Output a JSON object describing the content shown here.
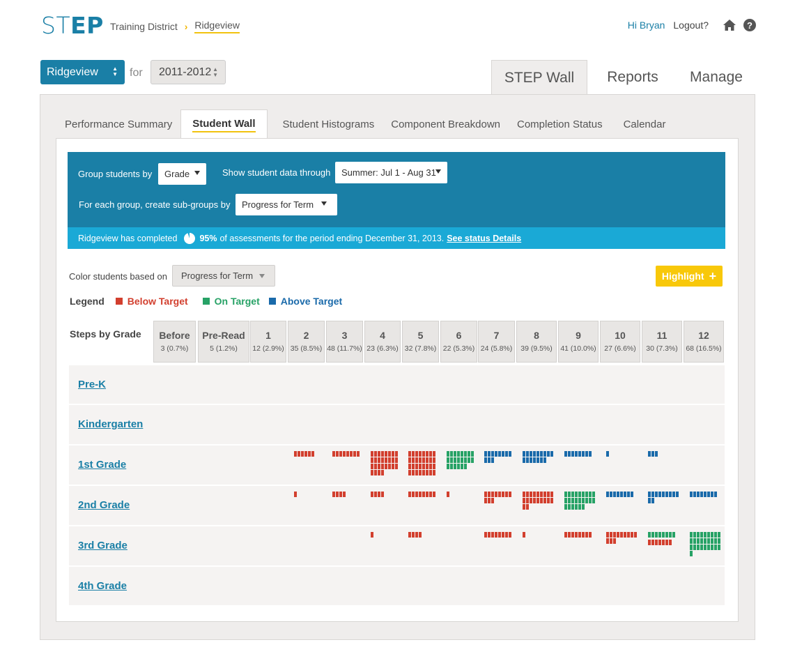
{
  "header": {
    "logo_part1": "ST",
    "logo_part2": "EP",
    "breadcrumbs": [
      "Training District",
      "Ridgeview"
    ],
    "greeting": "Hi Bryan",
    "logout": "Logout?",
    "home_icon": "home-icon",
    "help_icon": "help-icon",
    "help_glyph": "?"
  },
  "selectors": {
    "school": "Ridgeview",
    "for_label": "for",
    "year": "2011-2012"
  },
  "main_tabs": [
    "STEP Wall",
    "Reports",
    "Manage"
  ],
  "sub_tabs": [
    "Performance Summary",
    "Student Wall",
    "Student Histograms",
    "Component Breakdown",
    "Completion Status",
    "Calendar"
  ],
  "filters": {
    "group_label": "Group students by",
    "group_value": "Grade",
    "through_label": "Show student data through",
    "through_value": "Summer: Jul 1 - Aug 31",
    "subgroup_label": "For each group, create sub-groups by",
    "subgroup_value": "Progress for Term"
  },
  "completion": {
    "prefix": "Ridgeview has completed",
    "percent": "95%",
    "suffix": "of assessments for the period ending December 31, 2013.",
    "link": "See status Details"
  },
  "color_by": {
    "label": "Color students based on",
    "value": "Progress for Term",
    "highlight_label": "Highlight",
    "highlight_plus": "+"
  },
  "legend": {
    "title": "Legend",
    "items": [
      {
        "label": "Below Target",
        "color": "#d23f2e"
      },
      {
        "label": "On Target",
        "color": "#27a266"
      },
      {
        "label": "Above Target",
        "color": "#1a6aaa"
      }
    ]
  },
  "steps_title": "Steps by Grade",
  "steps": [
    {
      "name": "Before",
      "count": "3 (0.7%)"
    },
    {
      "name": "Pre-Read",
      "count": "5 (1.2%)"
    },
    {
      "name": "1",
      "count": "12 (2.9%)"
    },
    {
      "name": "2",
      "count": "35 (8.5%)"
    },
    {
      "name": "3",
      "count": "48 (11.7%)"
    },
    {
      "name": "4",
      "count": "23 (6.3%)"
    },
    {
      "name": "5",
      "count": "32 (7.8%)"
    },
    {
      "name": "6",
      "count": "22 (5.3%)"
    },
    {
      "name": "7",
      "count": "24 (5.8%)"
    },
    {
      "name": "8",
      "count": "39 (9.5%)"
    },
    {
      "name": "9",
      "count": "41 (10.0%)"
    },
    {
      "name": "10",
      "count": "27 (6.6%)"
    },
    {
      "name": "11",
      "count": "30 (7.3%)"
    },
    {
      "name": "12",
      "count": "68 (16.5%)"
    }
  ],
  "grades": [
    {
      "name": "Pre-K",
      "cells": []
    },
    {
      "name": "Kindergarten",
      "cells": []
    },
    {
      "name": "1st Grade",
      "cells": [
        {
          "step": "2",
          "status": "below",
          "count": 6
        },
        {
          "step": "3",
          "status": "below",
          "count": 8
        },
        {
          "step": "4",
          "status": "below",
          "count": 28
        },
        {
          "step": "5",
          "status": "below",
          "count": 32
        },
        {
          "step": "6",
          "status": "on",
          "count": 22
        },
        {
          "step": "7",
          "status": "above",
          "count": 11
        },
        {
          "step": "8",
          "status": "above",
          "count": 16
        },
        {
          "step": "9",
          "status": "above",
          "count": 8
        },
        {
          "step": "10",
          "status": "above",
          "count": 1
        },
        {
          "step": "11",
          "status": "above",
          "count": 3
        }
      ]
    },
    {
      "name": "2nd Grade",
      "cells": [
        {
          "step": "2",
          "status": "below",
          "count": 1
        },
        {
          "step": "3",
          "status": "below",
          "count": 4
        },
        {
          "step": "4",
          "status": "below",
          "count": 4
        },
        {
          "step": "5",
          "status": "below",
          "count": 8
        },
        {
          "step": "6",
          "status": "below",
          "count": 1
        },
        {
          "step": "7",
          "status": "below",
          "count": 11
        },
        {
          "step": "8",
          "status": "below",
          "count": 20
        },
        {
          "step": "9",
          "status": "on",
          "count": 24
        },
        {
          "step": "10",
          "status": "above",
          "count": 8
        },
        {
          "step": "11",
          "status": "above",
          "count": 11
        },
        {
          "step": "12",
          "status": "above",
          "count": 8
        }
      ]
    },
    {
      "name": "3rd Grade",
      "cells": [
        {
          "step": "4",
          "status": "below",
          "count": 1
        },
        {
          "step": "5",
          "status": "below",
          "count": 4
        },
        {
          "step": "7",
          "status": "below",
          "count": 8
        },
        {
          "step": "8",
          "status": "below",
          "count": 1
        },
        {
          "step": "9",
          "status": "below",
          "count": 8
        },
        {
          "step": "10",
          "status": "below",
          "count": 12
        },
        {
          "step": "11",
          "status": "on",
          "count": 8
        },
        {
          "step": "11b",
          "status": "below",
          "count": 7
        },
        {
          "step": "12",
          "status": "on",
          "count": 28
        }
      ]
    },
    {
      "name": "4th Grade",
      "cells": []
    }
  ]
}
